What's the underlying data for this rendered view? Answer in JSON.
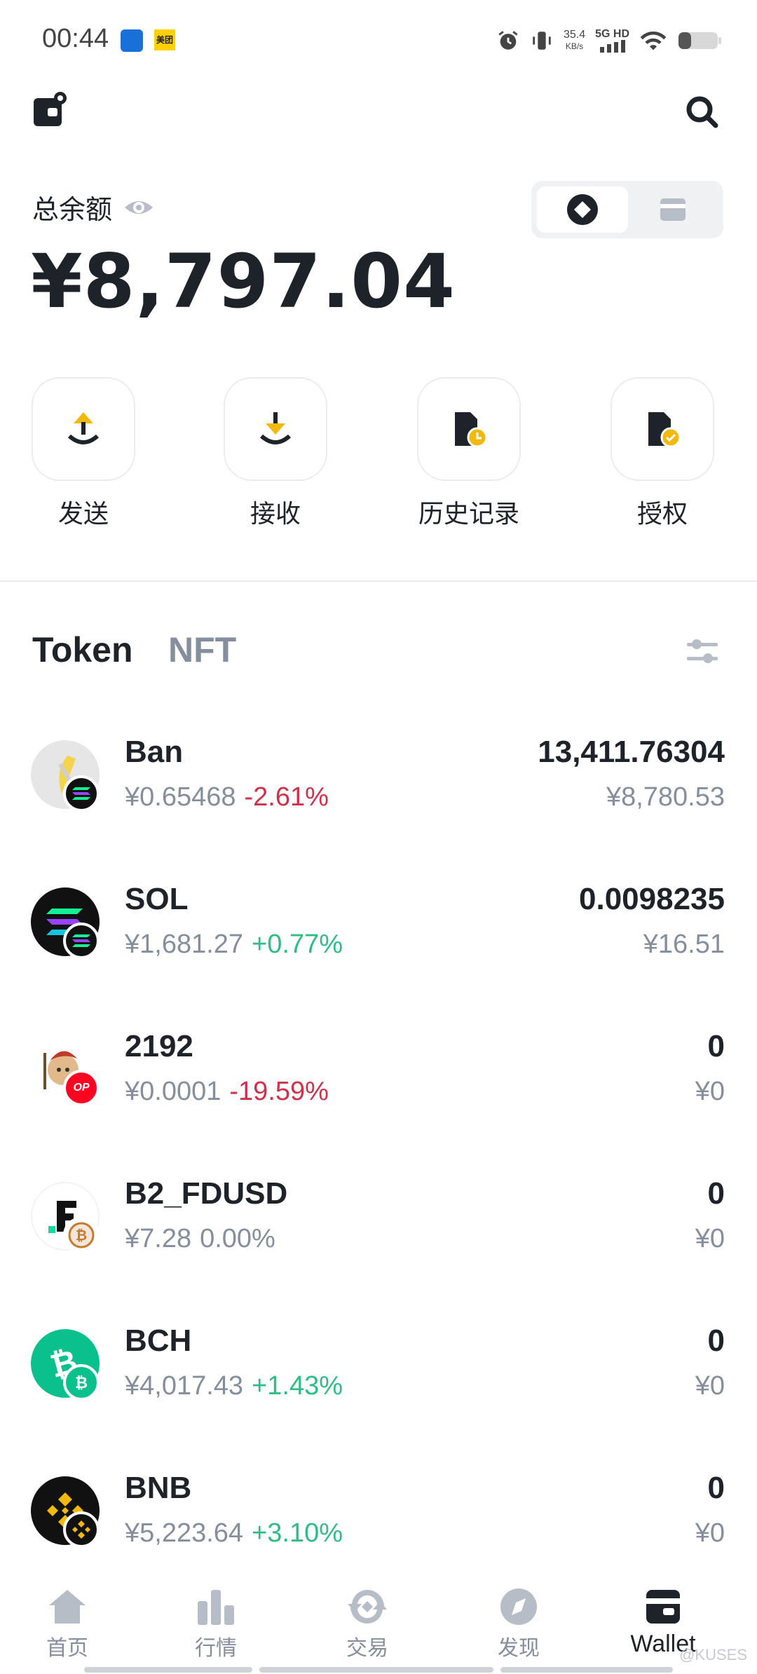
{
  "status_bar": {
    "time": "00:44",
    "app_badge": "美团",
    "net_speed_value": "35.4",
    "net_speed_unit": "KB/s",
    "network": "5G HD"
  },
  "header": {
    "wallet_icon": "wallet-settings-icon",
    "search_icon": "search-icon"
  },
  "balance": {
    "label": "总余额",
    "amount": "¥8,797.04"
  },
  "actions": [
    {
      "label": "发送",
      "icon": "send-icon"
    },
    {
      "label": "接收",
      "icon": "receive-icon"
    },
    {
      "label": "历史记录",
      "icon": "history-icon"
    },
    {
      "label": "授权",
      "icon": "approval-icon"
    }
  ],
  "tabs": {
    "token": "Token",
    "nft": "NFT"
  },
  "tokens": [
    {
      "name": "Ban",
      "price": "¥0.65468",
      "change": "-2.61%",
      "amount": "13,411.76304",
      "value": "¥8,780.53"
    },
    {
      "name": "SOL",
      "price": "¥1,681.27",
      "change": "+0.77%",
      "amount": "0.0098235",
      "value": "¥16.51"
    },
    {
      "name": "2192",
      "price": "¥0.0001",
      "change": "-19.59%",
      "amount": "0",
      "value": "¥0"
    },
    {
      "name": "B2_FDUSD",
      "price": "¥7.28",
      "change": "0.00%",
      "amount": "0",
      "value": "¥0"
    },
    {
      "name": "BCH",
      "price": "¥4,017.43",
      "change": "+1.43%",
      "amount": "0",
      "value": "¥0"
    },
    {
      "name": "BNB",
      "price": "¥5,223.64",
      "change": "+3.10%",
      "amount": "0",
      "value": "¥0"
    }
  ],
  "colors": {
    "up": "#2ebd85",
    "down": "#cf304a",
    "accent": "#f0b90b"
  },
  "bottom_nav": [
    {
      "label": "首页"
    },
    {
      "label": "行情"
    },
    {
      "label": "交易"
    },
    {
      "label": "发现"
    },
    {
      "label": "Wallet"
    }
  ],
  "watermark": "@KUSES"
}
